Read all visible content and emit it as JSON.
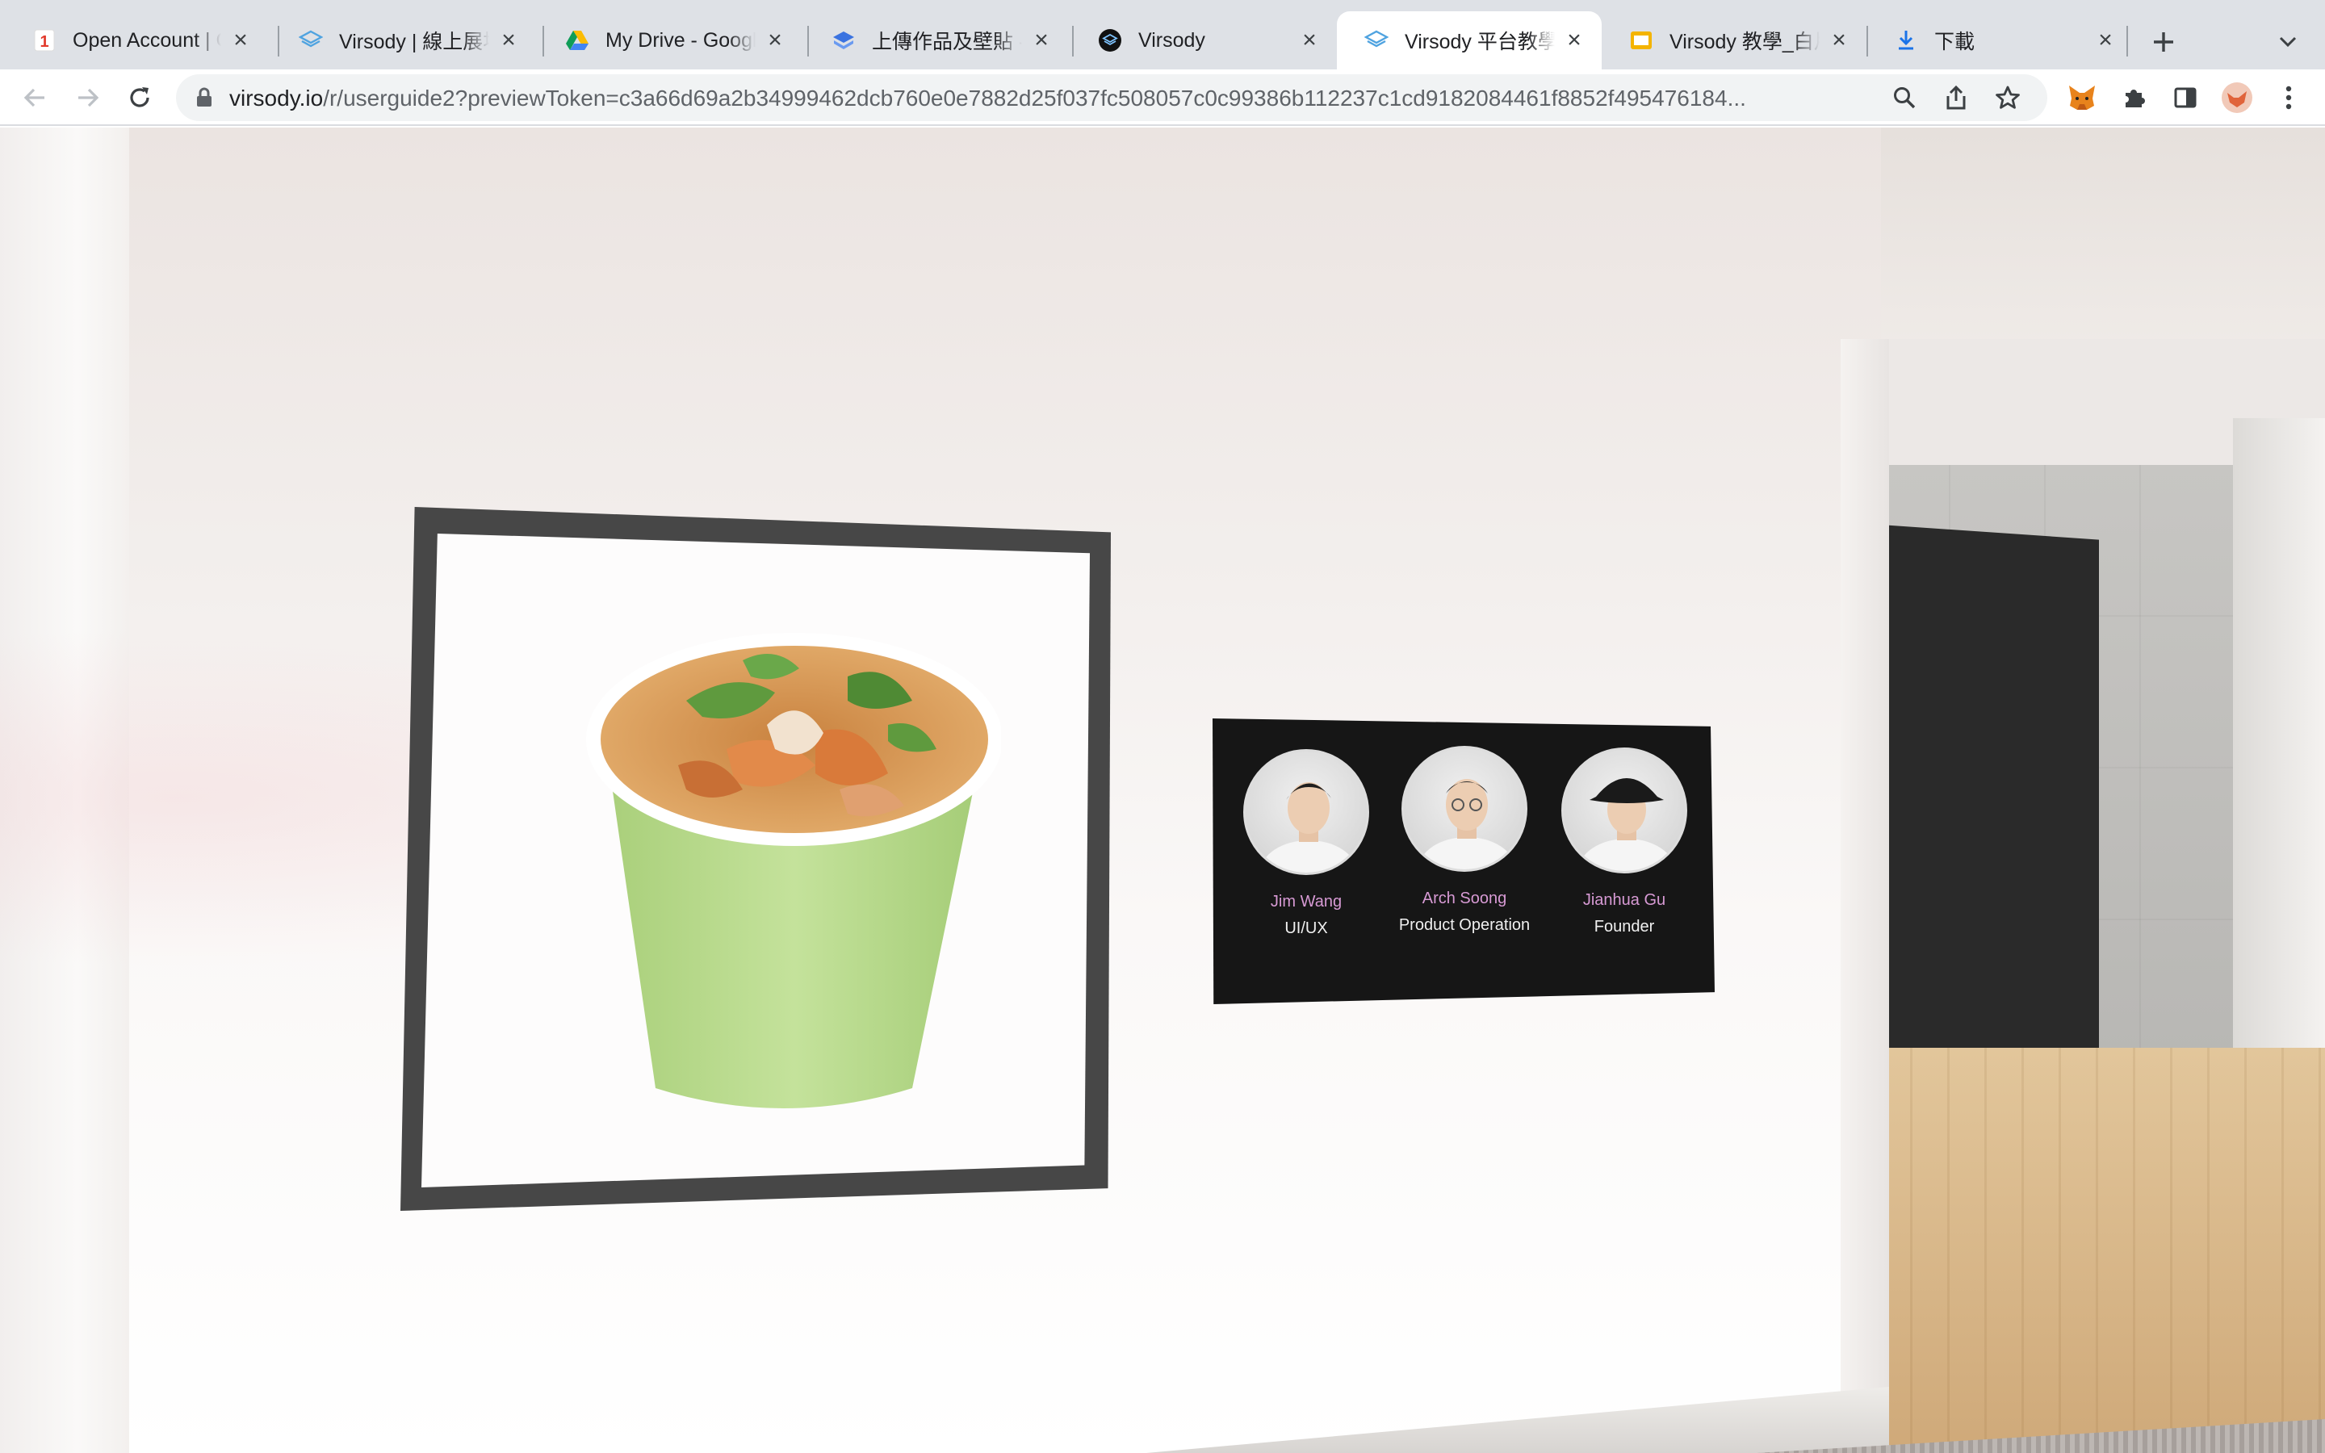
{
  "browser": {
    "tabs": [
      {
        "title": "Open Account | C",
        "favicon": "number-one-icon",
        "active": false
      },
      {
        "title": "Virsody | 線上展場",
        "favicon": "virsody-layers-icon",
        "active": false
      },
      {
        "title": "My Drive - Google",
        "favicon": "google-drive-icon",
        "active": false
      },
      {
        "title": "上傳作品及壁貼 - V",
        "favicon": "stack-blue-icon",
        "active": false
      },
      {
        "title": "Virsody",
        "favicon": "virsody-dark-icon",
        "active": false
      },
      {
        "title": "Virsody 平台教學",
        "favicon": "virsody-layers-icon",
        "active": true
      },
      {
        "title": "Virsody 教學_白片",
        "favicon": "google-slides-icon",
        "active": false
      },
      {
        "title": "下載",
        "favicon": "download-icon",
        "active": false
      }
    ],
    "url_host": "virsody.io",
    "url_path": "/r/userguide2?previewToken=c3a66d69a2b34999462dcb760e0e7882d25f037fc508057c0c99386b112237c1cd9182084461f8852f495476184..."
  },
  "scene": {
    "artwork_name": "soup-cup-artwork",
    "team": [
      {
        "name": "Jim Wang",
        "role": "UI/UX"
      },
      {
        "name": "Arch Soong",
        "role": "Product Operation"
      },
      {
        "name": "Jianhua Gu",
        "role": "Founder"
      }
    ],
    "colors": {
      "member_name": "#d79ad4",
      "board_bg": "#161616",
      "frame": "#474747",
      "cup_green": "#b7d98b"
    }
  }
}
